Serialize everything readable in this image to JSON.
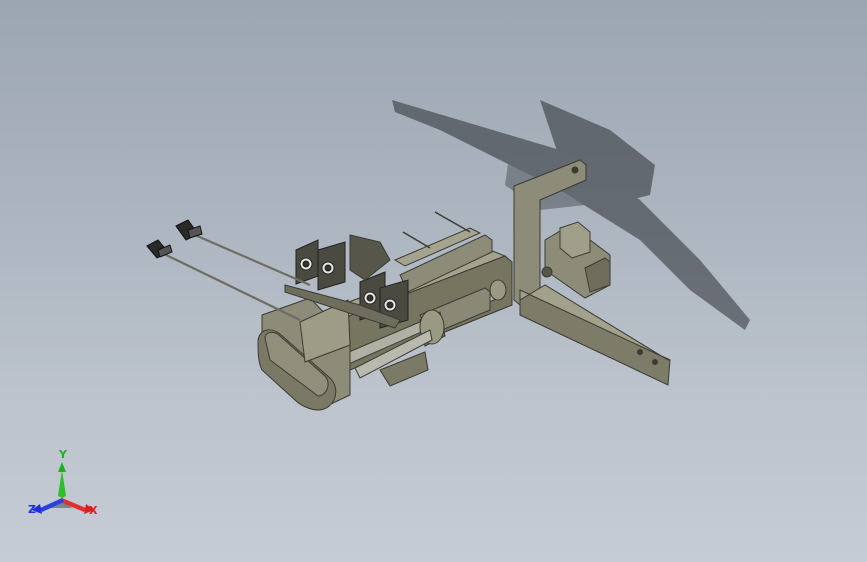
{
  "viewport": {
    "background_top": "#9ca6b2",
    "background_bottom": "#c6ccd5"
  },
  "model": {
    "body_color": "#8d8c78",
    "dark_color": "#3b3b33",
    "shadow_color": "#2c2f34"
  },
  "triad": {
    "x_label": "X",
    "y_label": "Y",
    "z_label": "Z",
    "x_color": "#d82020",
    "y_color": "#1fb01f",
    "z_color": "#2030d8"
  }
}
